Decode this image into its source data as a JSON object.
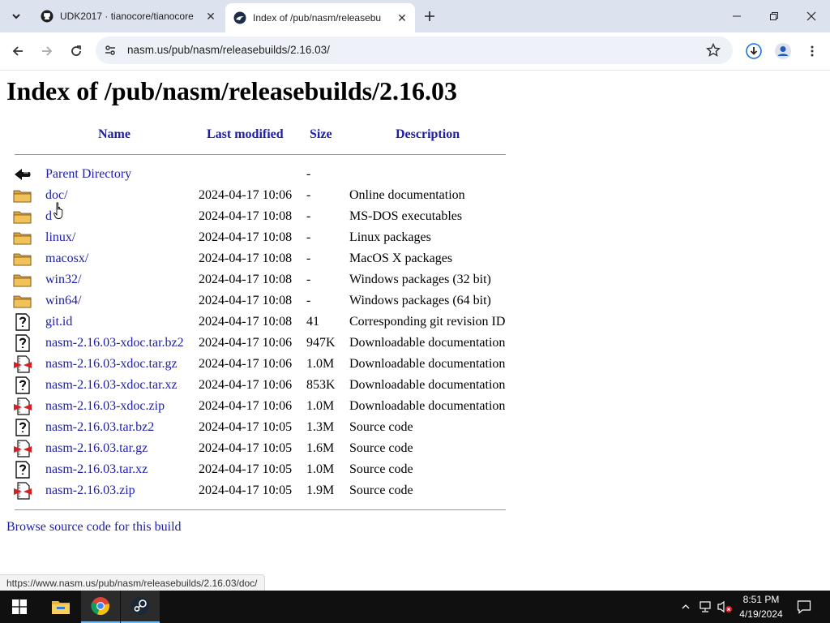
{
  "browser": {
    "tabs": [
      {
        "title": "UDK2017 · tianocore/tianocore",
        "active": false
      },
      {
        "title": "Index of /pub/nasm/releasebu",
        "active": true
      }
    ],
    "url": "nasm.us/pub/nasm/releasebuilds/2.16.03/"
  },
  "page": {
    "heading": "Index of /pub/nasm/releasebuilds/2.16.03",
    "columns": {
      "name": "Name",
      "modified": "Last modified",
      "size": "Size",
      "description": "Description"
    },
    "rows": [
      {
        "icon": "back-arrow-icon",
        "name": "Parent Directory",
        "date": "",
        "size": "-",
        "desc": ""
      },
      {
        "icon": "folder-icon",
        "name": "doc/",
        "date": "2024-04-17 10:06",
        "size": "-",
        "desc": "Online documentation"
      },
      {
        "icon": "folder-icon",
        "name": "d",
        "date": "2024-04-17 10:08",
        "size": "-",
        "desc": "MS-DOS executables"
      },
      {
        "icon": "folder-icon",
        "name": "linux/",
        "date": "2024-04-17 10:08",
        "size": "-",
        "desc": "Linux packages"
      },
      {
        "icon": "folder-icon",
        "name": "macosx/",
        "date": "2024-04-17 10:08",
        "size": "-",
        "desc": "MacOS X packages"
      },
      {
        "icon": "folder-icon",
        "name": "win32/",
        "date": "2024-04-17 10:08",
        "size": "-",
        "desc": "Windows packages (32 bit)"
      },
      {
        "icon": "folder-icon",
        "name": "win64/",
        "date": "2024-04-17 10:08",
        "size": "-",
        "desc": "Windows packages (64 bit)"
      },
      {
        "icon": "unknown-file-icon",
        "name": "git.id",
        "date": "2024-04-17 10:08",
        "size": "41",
        "desc": "Corresponding git revision ID"
      },
      {
        "icon": "unknown-file-icon",
        "name": "nasm-2.16.03-xdoc.tar.bz2",
        "date": "2024-04-17 10:06",
        "size": "947K",
        "desc": "Downloadable documentation"
      },
      {
        "icon": "compressed-file-icon",
        "name": "nasm-2.16.03-xdoc.tar.gz",
        "date": "2024-04-17 10:06",
        "size": "1.0M",
        "desc": "Downloadable documentation"
      },
      {
        "icon": "unknown-file-icon",
        "name": "nasm-2.16.03-xdoc.tar.xz",
        "date": "2024-04-17 10:06",
        "size": "853K",
        "desc": "Downloadable documentation"
      },
      {
        "icon": "compressed-file-icon",
        "name": "nasm-2.16.03-xdoc.zip",
        "date": "2024-04-17 10:06",
        "size": "1.0M",
        "desc": "Downloadable documentation"
      },
      {
        "icon": "unknown-file-icon",
        "name": "nasm-2.16.03.tar.bz2",
        "date": "2024-04-17 10:05",
        "size": "1.3M",
        "desc": "Source code"
      },
      {
        "icon": "compressed-file-icon",
        "name": "nasm-2.16.03.tar.gz",
        "date": "2024-04-17 10:05",
        "size": "1.6M",
        "desc": "Source code"
      },
      {
        "icon": "unknown-file-icon",
        "name": "nasm-2.16.03.tar.xz",
        "date": "2024-04-17 10:05",
        "size": "1.0M",
        "desc": "Source code"
      },
      {
        "icon": "compressed-file-icon",
        "name": "nasm-2.16.03.zip",
        "date": "2024-04-17 10:05",
        "size": "1.9M",
        "desc": "Source code"
      }
    ],
    "browse_link": "Browse source code for this build"
  },
  "status_bar": "https://www.nasm.us/pub/nasm/releasebuilds/2.16.03/doc/",
  "taskbar": {
    "apps": [
      "start-icon",
      "file-explorer-icon",
      "chrome-icon",
      "steam-icon"
    ],
    "time": "8:51 PM",
    "date": "4/19/2024"
  },
  "colors": {
    "link": "#1d1da7",
    "tabstrip": "#dde3ee",
    "taskbar": "#101010"
  }
}
